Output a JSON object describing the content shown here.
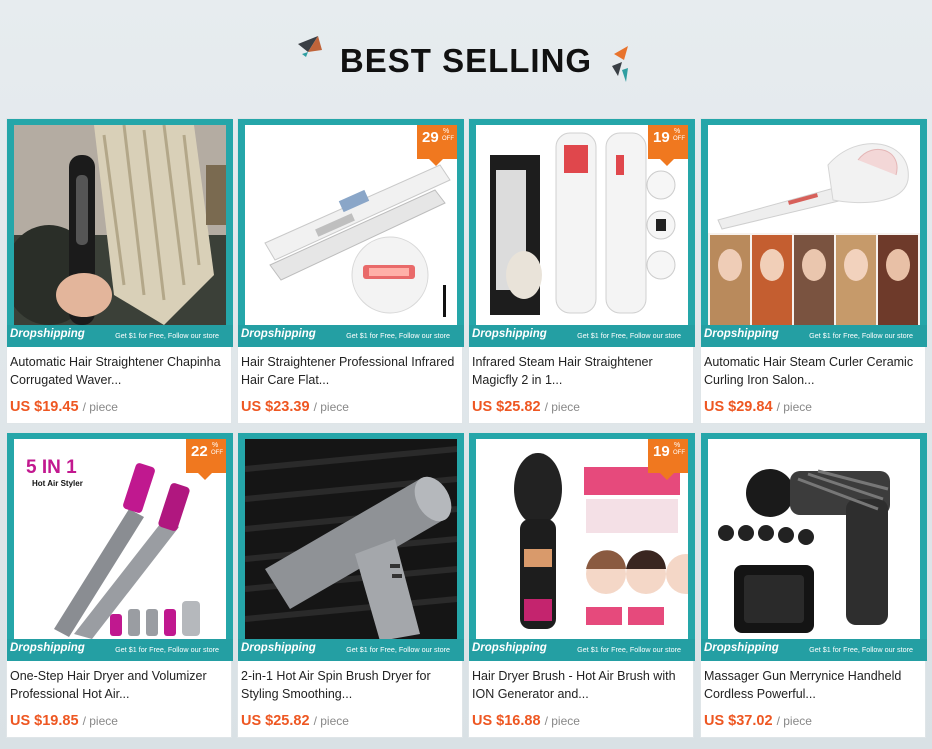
{
  "header": {
    "title": "BEST SELLING"
  },
  "strip": {
    "brand": "Dropshipping",
    "promo": "Get $1 for Free, Follow our store"
  },
  "colors": {
    "accent_teal": "#249fa3",
    "price_orange": "#ee5722",
    "badge_orange": "#f0781f"
  },
  "products": [
    {
      "name": "Automatic Hair Straightener Chapinha Corrugated Waver...",
      "price": "US $19.45",
      "unit": "/ piece",
      "badge": null
    },
    {
      "name": "Hair Straightener Professional Infrared Hair Care Flat...",
      "price": "US $23.39",
      "unit": "/ piece",
      "badge": {
        "num": "29",
        "pct": "%",
        "off": "OFF"
      }
    },
    {
      "name": "Infrared Steam Hair Straightener Magicfly 2 in 1...",
      "price": "US $25.82",
      "unit": "/ piece",
      "badge": {
        "num": "19",
        "pct": "%",
        "off": "OFF"
      }
    },
    {
      "name": "Automatic Hair Steam Curler Ceramic Curling Iron Salon...",
      "price": "US $29.84",
      "unit": "/ piece",
      "badge": null
    },
    {
      "name": "One-Step Hair Dryer and Volumizer Professional Hot Air...",
      "price": "US $19.85",
      "unit": "/ piece",
      "badge": {
        "num": "22",
        "pct": "%",
        "off": "OFF"
      },
      "image_text": {
        "big": "5 IN 1",
        "small": "Hot Air Styler"
      }
    },
    {
      "name": "2-in-1 Hot Air Spin Brush Dryer for Styling Smoothing...",
      "price": "US $25.82",
      "unit": "/ piece",
      "badge": null
    },
    {
      "name": "Hair Dryer Brush - Hot Air Brush with ION Generator and...",
      "price": "US $16.88",
      "unit": "/ piece",
      "badge": {
        "num": "19",
        "pct": "%",
        "off": "OFF"
      }
    },
    {
      "name": "Massager Gun Merrynice Handheld Cordless Powerful...",
      "price": "US $37.02",
      "unit": "/ piece",
      "badge": null
    }
  ]
}
